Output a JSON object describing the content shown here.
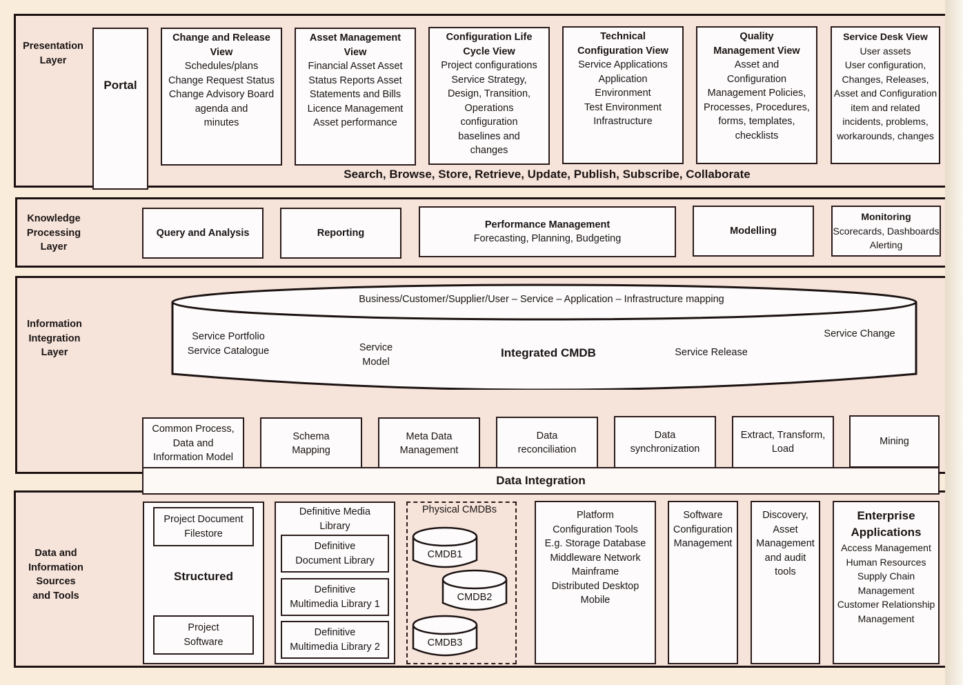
{
  "presentation": {
    "label": [
      "Presentation",
      "Layer"
    ],
    "portal": "Portal",
    "views": [
      {
        "title": [
          "Change and Release",
          "View"
        ],
        "items": [
          "Schedules/plans",
          "Change Request Status",
          "Change Advisory Board",
          "agenda and",
          "minutes"
        ]
      },
      {
        "title": [
          "Asset Management",
          "View"
        ],
        "items": [
          "Financial Asset Asset",
          "Status Reports Asset",
          "Statements and Bills",
          "Licence Management",
          "Asset performance"
        ]
      },
      {
        "title": [
          "Configuration Life",
          "Cycle View"
        ],
        "items": [
          "Project configurations",
          "Service Strategy,",
          "Design, Transition,",
          "Operations",
          "configuration",
          "baselines and",
          "changes"
        ]
      },
      {
        "title": [
          "Technical",
          "Configuration View"
        ],
        "items": [
          "Service Applications",
          "Application",
          "Environment",
          "Test Environment",
          "Infrastructure"
        ]
      },
      {
        "title": [
          "Quality",
          "Management View"
        ],
        "items": [
          "Asset and",
          "Configuration",
          "Management Policies,",
          "Processes, Procedures,",
          "forms, templates,",
          "checklists"
        ]
      },
      {
        "title": [
          "Service Desk View"
        ],
        "items": [
          "User assets",
          "User configuration,",
          "Changes, Releases,",
          "Asset and Configuration",
          "item and related",
          "incidents, problems,",
          "workarounds, changes"
        ]
      }
    ],
    "actions": "Search, Browse, Store, Retrieve, Update, Publish, Subscribe, Collaborate"
  },
  "knowledge": {
    "label": [
      "Knowledge",
      "Processing",
      "Layer"
    ],
    "boxes": [
      {
        "title": "Query and Analysis",
        "items": []
      },
      {
        "title": "Reporting",
        "items": []
      },
      {
        "title": "Performance Management",
        "items": [
          "Forecasting, Planning, Budgeting"
        ]
      },
      {
        "title": "Modelling",
        "items": []
      },
      {
        "title": "Monitoring",
        "items": [
          "Scorecards, Dashboards",
          "Alerting"
        ]
      }
    ]
  },
  "integration": {
    "label": [
      "Information",
      "Integration",
      "Layer"
    ],
    "cmdb": {
      "mapping": "Business/Customer/Supplier/User – Service – Application – Infrastructure mapping",
      "title": "Integrated CMDB",
      "portfolio": [
        "Service Portfolio",
        "Service Catalogue"
      ],
      "model": [
        "Service",
        "Model"
      ],
      "release": "Service Release",
      "change": "Service Change"
    },
    "boxes": [
      [
        "Common Process,",
        "Data and",
        "Information Model"
      ],
      [
        "Schema",
        "Mapping"
      ],
      [
        "Meta Data",
        "Management"
      ],
      [
        "Data",
        "reconciliation"
      ],
      [
        "Data",
        "synchronization"
      ],
      [
        "Extract, Transform,",
        "Load"
      ],
      [
        "Mining"
      ]
    ],
    "data_integration": "Data Integration"
  },
  "sources": {
    "label": [
      "Data and",
      "Information",
      "Sources",
      "and Tools"
    ],
    "structured": {
      "title": "Structured",
      "filestore": [
        "Project Document",
        "Filestore"
      ],
      "software": [
        "Project",
        "Software"
      ]
    },
    "dml": {
      "title": [
        "Definitive Media",
        "Library"
      ],
      "items": [
        [
          "Definitive",
          "Document Library"
        ],
        [
          "Definitive",
          "Multimedia Library 1"
        ],
        [
          "Definitive",
          "Multimedia Library 2"
        ]
      ]
    },
    "physical": {
      "title": "Physical CMDBs",
      "dbs": [
        "CMDB1",
        "CMDB2",
        "CMDB3"
      ]
    },
    "platform": [
      "Platform",
      "Configuration Tools",
      "E.g. Storage Database",
      "Middleware Network",
      "Mainframe",
      "Distributed Desktop",
      "Mobile"
    ],
    "software_cm": [
      "Software",
      "Configuration",
      "Management"
    ],
    "discovery": [
      "Discovery,",
      "Asset",
      "Management",
      "and audit",
      "tools"
    ],
    "enterprise": {
      "title": [
        "Enterprise",
        "Applications"
      ],
      "items": [
        "Access Management",
        "Human Resources",
        "Supply Chain",
        "Management",
        "Customer Relationship",
        "Management"
      ]
    }
  }
}
